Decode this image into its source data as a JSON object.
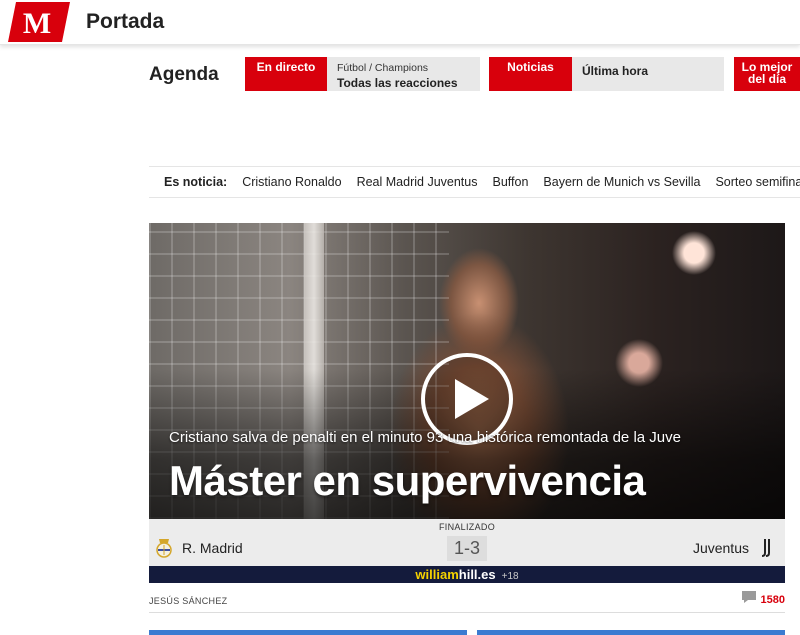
{
  "header": {
    "logo_letter": "M",
    "section_title": "Portada",
    "brand_color": "#d8000c"
  },
  "agenda": {
    "label": "Agenda",
    "cards": [
      {
        "tag": "En directo",
        "sub": "Fútbol / Champions",
        "main": "Todas las reacciones"
      },
      {
        "tag": "Noticias",
        "sub": "",
        "main": "Última hora"
      },
      {
        "tag": "Lo mejor del día",
        "sub": "",
        "main": ""
      }
    ]
  },
  "trending": {
    "label": "Es noticia:",
    "links": [
      "Cristiano Ronaldo",
      "Real Madrid Juventus",
      "Buffon",
      "Bayern de Munich vs Sevilla",
      "Sorteo semifinales"
    ]
  },
  "hero": {
    "subtitle": "Cristiano salva de penalti en el minuto 93 una histórica remontada de la Juve",
    "title": "Máster en supervivencia",
    "play_icon": "play-icon"
  },
  "match": {
    "status": "FINALIZADO",
    "result": "1-3",
    "home_team": "R. Madrid",
    "away_team": "Juventus"
  },
  "sponsor": {
    "brand": "william",
    "brand_bold": "hill",
    "tld": ".es",
    "age": "+18"
  },
  "article": {
    "author": "JESÚS SÁNCHEZ",
    "comments": "1580"
  }
}
